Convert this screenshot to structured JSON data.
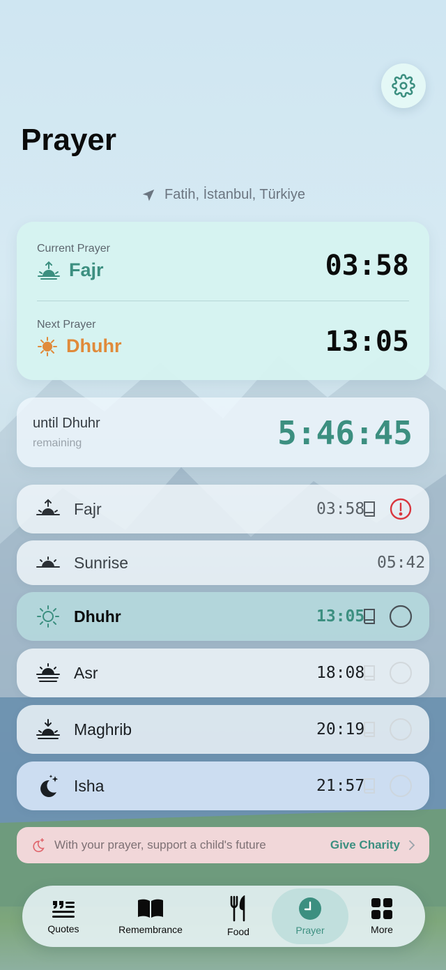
{
  "colors": {
    "accent": "#3c8f80",
    "next_accent": "#e08a3a",
    "alert": "#d9363e"
  },
  "header": {
    "title": "Prayer",
    "settings_icon": "gear-icon"
  },
  "location": {
    "text": "Fatih, İstanbul, Türkiye",
    "icon": "location-arrow-icon"
  },
  "current": {
    "label": "Current Prayer",
    "name": "Fajr",
    "time": "03:58",
    "next_label": "Next Prayer",
    "next_name": "Dhuhr",
    "next_time": "13:05"
  },
  "countdown": {
    "until": "until Dhuhr",
    "remaining": "remaining",
    "time": "5:46:45"
  },
  "prayers": [
    {
      "name": "Fajr",
      "time": "03:58",
      "icon": "fajr-sunrise-arrow-icon",
      "status": "missed-alert"
    },
    {
      "name": "Sunrise",
      "time": "05:42",
      "icon": "sunrise-icon",
      "status": "none"
    },
    {
      "name": "Dhuhr",
      "time": "13:05",
      "icon": "sun-icon",
      "status": "current-unchecked"
    },
    {
      "name": "Asr",
      "time": "18:08",
      "icon": "sun-horizon-icon",
      "status": "upcoming"
    },
    {
      "name": "Maghrib",
      "time": "20:19",
      "icon": "sunset-arrow-icon",
      "status": "upcoming"
    },
    {
      "name": "Isha",
      "time": "21:57",
      "icon": "moon-stars-icon",
      "status": "upcoming"
    }
  ],
  "charity": {
    "text": "With your prayer, support a child's future",
    "link": "Give Charity"
  },
  "tabs": [
    {
      "label": "Quotes",
      "icon": "quote-icon"
    },
    {
      "label": "Remembrance",
      "icon": "book-icon"
    },
    {
      "label": "Food",
      "icon": "fork-knife-icon"
    },
    {
      "label": "Prayer",
      "icon": "clock-icon",
      "active": true
    },
    {
      "label": "More",
      "icon": "grid-icon"
    }
  ]
}
